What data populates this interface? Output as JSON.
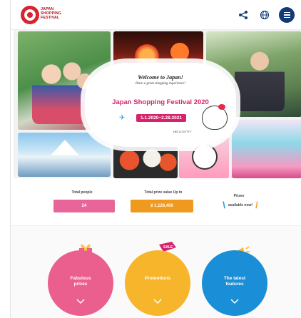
{
  "header": {
    "logo_lines": [
      "JAPAN",
      "SHOPPING",
      "FESTIVAL"
    ],
    "icons": [
      "share-icon",
      "globe-icon",
      "menu-icon"
    ]
  },
  "hero": {
    "welcome": "Welcome to Japan!",
    "subtitle": "Have a great shopping experience!",
    "title": "Japan Shopping Festival 2020",
    "dates": "1.1.2020~2.28.2021",
    "hello_kitty": "HELLO KITTY"
  },
  "stats": {
    "total_people_label": "Total people",
    "total_people_value": "24",
    "prize_label": "Total prize value Up to",
    "prize_value": "¥ 1,126,400",
    "prizes_label": "Prizes",
    "prizes_note": "available now!"
  },
  "features": [
    {
      "label_line1": "Fabulous",
      "label_line2": "prizes",
      "color": "#eb5f8e"
    },
    {
      "label_line1": "Promotions",
      "label_line2": "",
      "color": "#f7b52b"
    },
    {
      "label_line1": "The latest",
      "label_line2": "features",
      "color": "#1a8ed6"
    }
  ],
  "colors": {
    "brand_red": "#d9232d",
    "pink": "#d6236b",
    "navy": "#123a7a"
  }
}
